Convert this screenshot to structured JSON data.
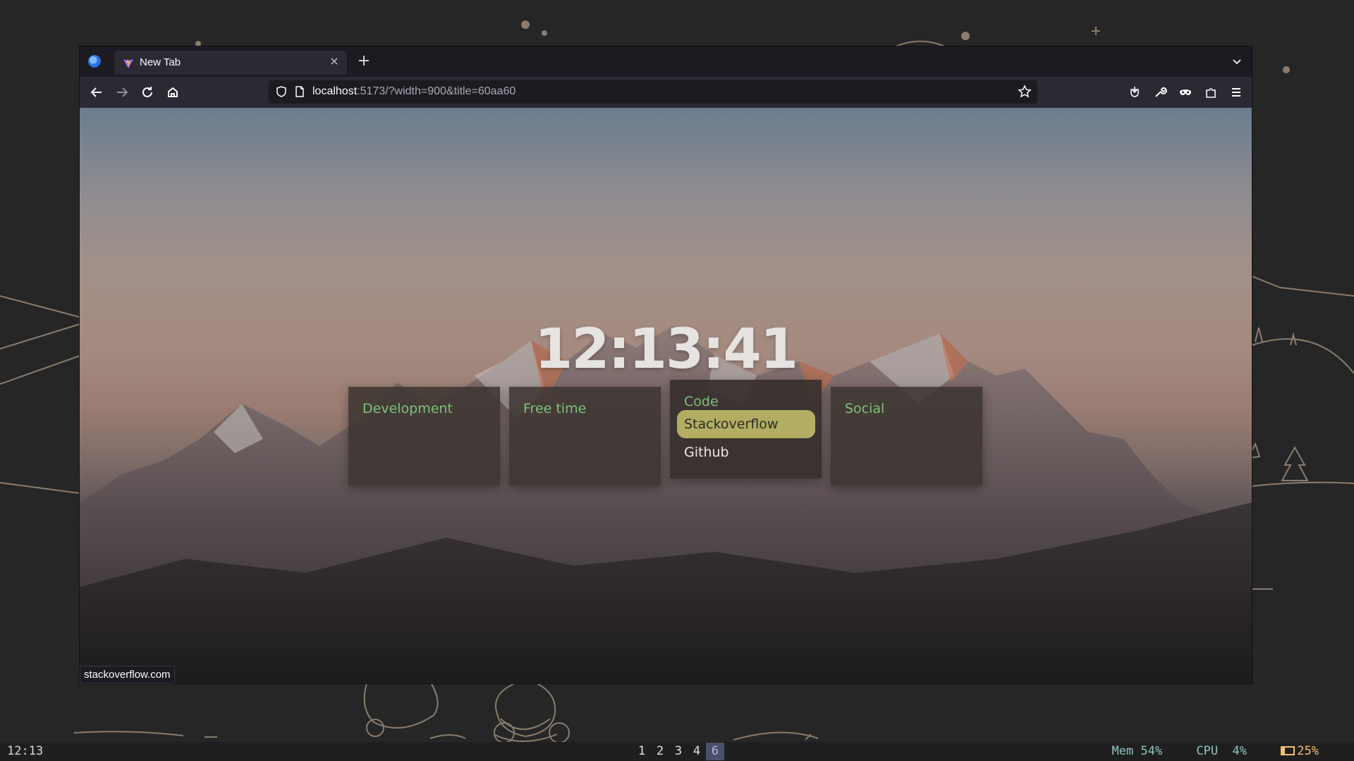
{
  "browser": {
    "tab": {
      "title": "New Tab",
      "close_label": "×"
    },
    "new_tab_label": "+",
    "url": {
      "host": "localhost",
      "rest": ":5173/?width=900&title=60aa60"
    },
    "status_url": "stackoverflow.com"
  },
  "startpage": {
    "clock": "12:13:41",
    "cards": [
      {
        "title": "Development",
        "links": []
      },
      {
        "title": "Free time",
        "links": []
      },
      {
        "title": "Code",
        "links": [
          "Stackoverflow",
          "Github"
        ],
        "highlighted": "Stackoverflow"
      },
      {
        "title": "Social",
        "links": []
      }
    ],
    "accent_color": "#7ec07a",
    "highlight_color": "#b2ad62"
  },
  "sysbar": {
    "time": "12:13",
    "workspaces": [
      "1",
      "2",
      "3",
      "4",
      "6"
    ],
    "active_workspace": "6",
    "mem": "Mem 54%",
    "cpu": "CPU  4%",
    "battery": "25%"
  }
}
